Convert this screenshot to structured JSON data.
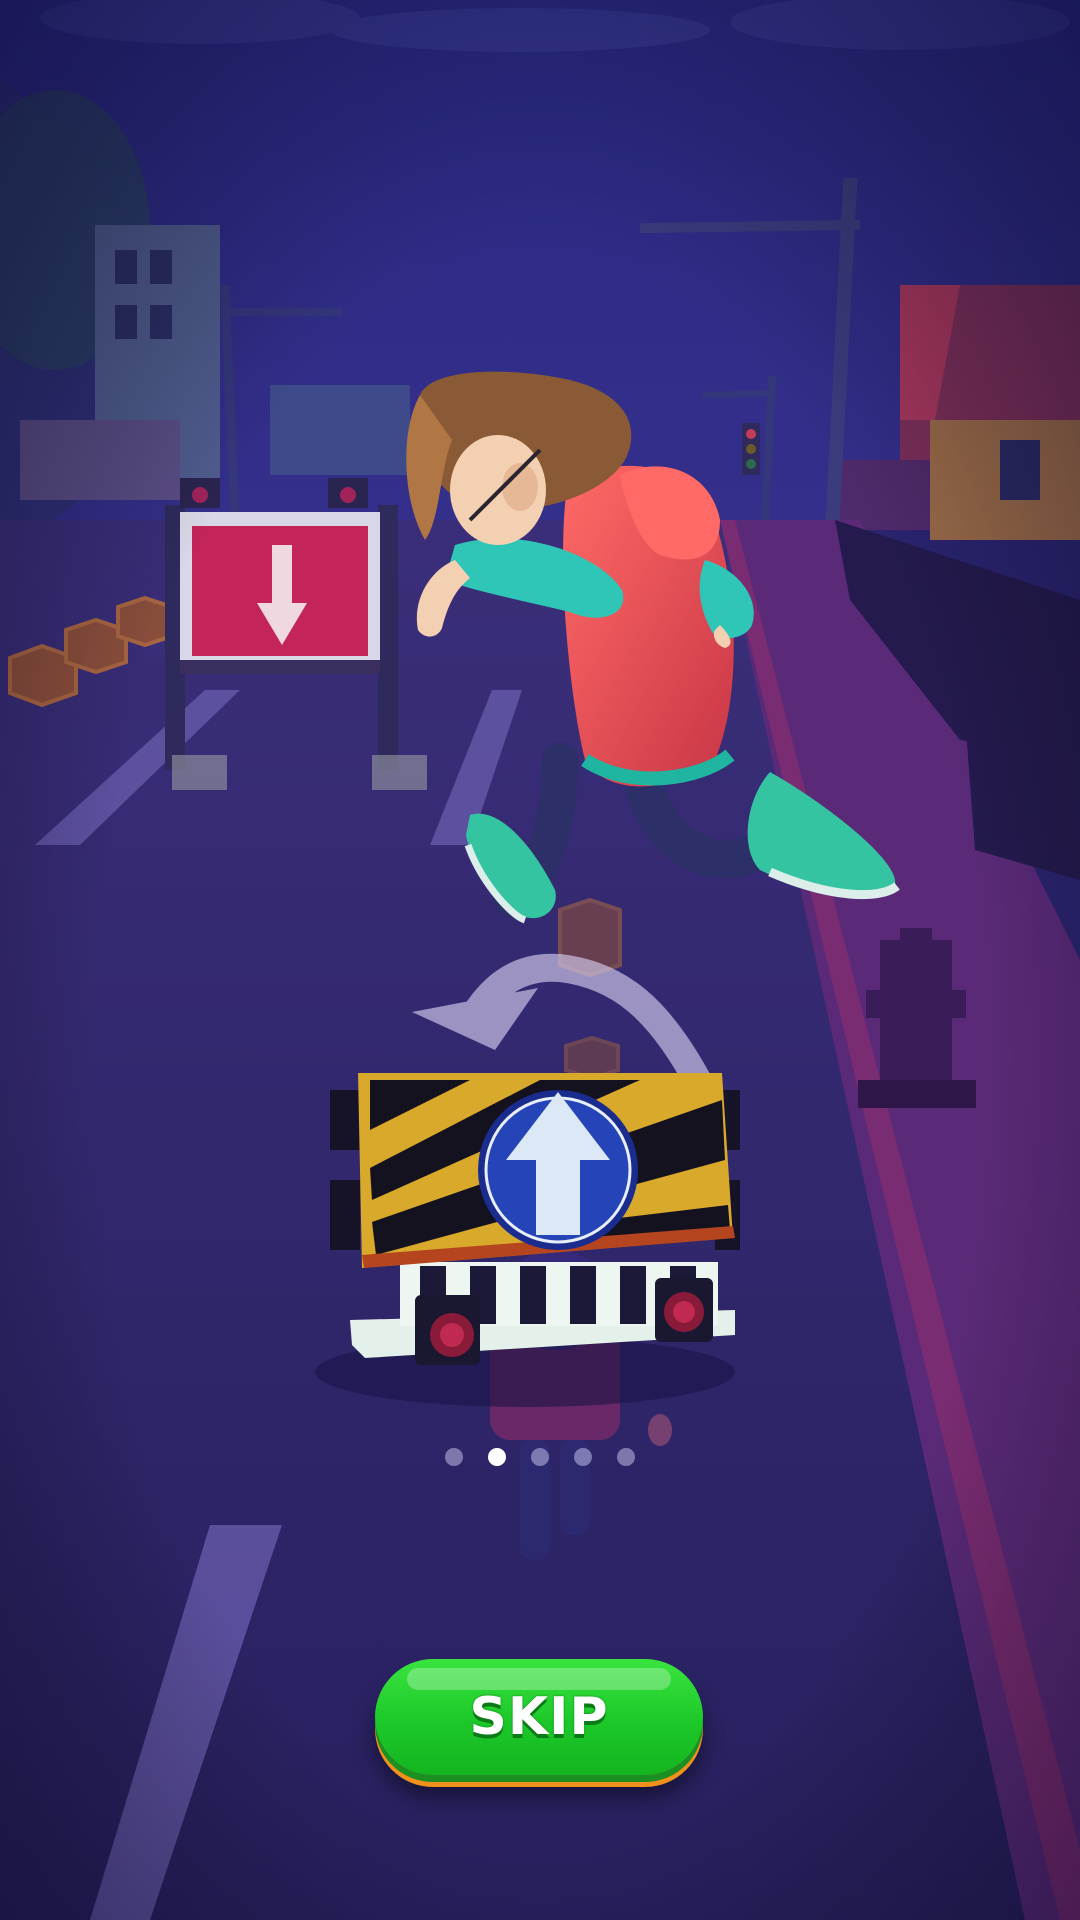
{
  "tutorial": {
    "page_count": 5,
    "current_page": 2
  },
  "skip_button": {
    "label": "SKIP"
  },
  "colors": {
    "night_sky": "#2a2470",
    "road": "#2d2368",
    "sidewalk": "#5a2a7a",
    "skip_green": "#1cc829",
    "skip_orange_edge": "#f0901d"
  },
  "icons": {
    "jump_arrow": "curved-jump-arrow-icon",
    "go_up_sign": "up-arrow-sign-icon",
    "go_down_sign": "down-arrow-sign-icon"
  }
}
